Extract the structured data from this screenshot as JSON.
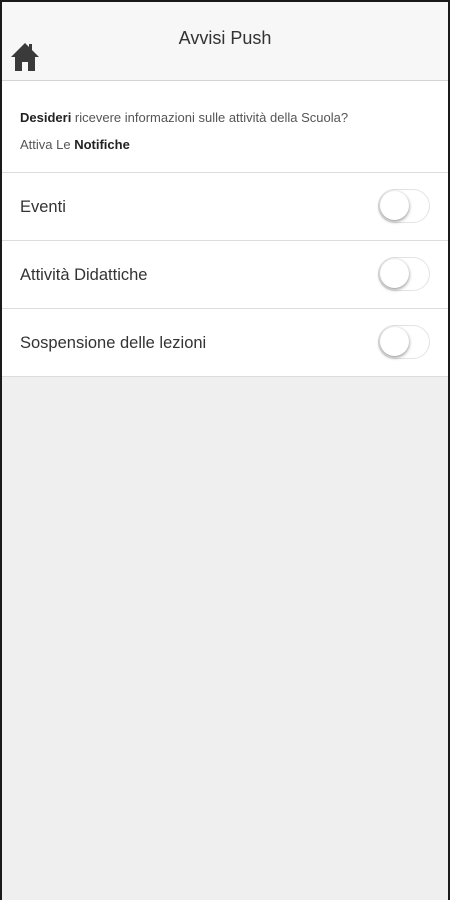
{
  "header": {
    "title": "Avvisi Push",
    "home_icon": "home-icon"
  },
  "intro": {
    "line1_bold": "Desideri",
    "line1_rest": " ricevere informazioni sulle attività della Scuola?",
    "line2_prefix": "Attiva Le ",
    "line2_bold": "Notifiche"
  },
  "settings": [
    {
      "label": "Eventi",
      "enabled": false
    },
    {
      "label": "Attività Didattiche",
      "enabled": false
    },
    {
      "label": "Sospensione delle lezioni",
      "enabled": false
    }
  ],
  "colors": {
    "toggle_on": "#4cd964",
    "page_background": "#efefef"
  }
}
